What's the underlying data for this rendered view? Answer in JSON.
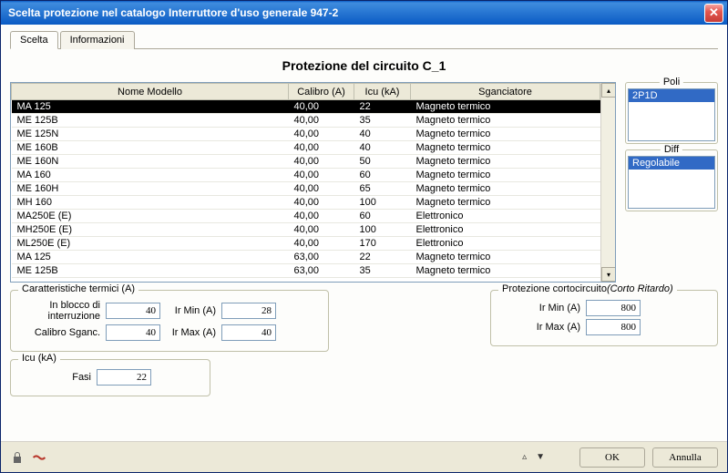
{
  "window": {
    "title": "Scelta protezione nel catalogo Interruttore d'uso generale 947-2"
  },
  "tabs": {
    "t0": "Scelta",
    "t1": "Informazioni"
  },
  "page_title": "Protezione del circuito C_1",
  "table": {
    "headers": {
      "modello": "Nome Modello",
      "calibro": "Calibro (A)",
      "icu": "Icu (kA)",
      "sganciatore": "Sganciatore"
    },
    "rows": [
      {
        "m": "MA 125",
        "c": "40,00",
        "i": "22",
        "s": "Magneto termico",
        "sel": true
      },
      {
        "m": "ME 125B",
        "c": "40,00",
        "i": "35",
        "s": "Magneto termico",
        "sel": false
      },
      {
        "m": "ME 125N",
        "c": "40,00",
        "i": "40",
        "s": "Magneto termico",
        "sel": false
      },
      {
        "m": "ME 160B",
        "c": "40,00",
        "i": "40",
        "s": "Magneto termico",
        "sel": false
      },
      {
        "m": "ME 160N",
        "c": "40,00",
        "i": "50",
        "s": "Magneto termico",
        "sel": false
      },
      {
        "m": "MA 160",
        "c": "40,00",
        "i": "60",
        "s": "Magneto termico",
        "sel": false
      },
      {
        "m": "ME 160H",
        "c": "40,00",
        "i": "65",
        "s": "Magneto termico",
        "sel": false
      },
      {
        "m": "MH 160",
        "c": "40,00",
        "i": "100",
        "s": "Magneto termico",
        "sel": false
      },
      {
        "m": "MA250E (E)",
        "c": "40,00",
        "i": "60",
        "s": "Elettronico",
        "sel": false
      },
      {
        "m": "MH250E (E)",
        "c": "40,00",
        "i": "100",
        "s": "Elettronico",
        "sel": false
      },
      {
        "m": "ML250E (E)",
        "c": "40,00",
        "i": "170",
        "s": "Elettronico",
        "sel": false
      },
      {
        "m": "MA 125",
        "c": "63,00",
        "i": "22",
        "s": "Magneto termico",
        "sel": false
      },
      {
        "m": "ME 125B",
        "c": "63,00",
        "i": "35",
        "s": "Magneto termico",
        "sel": false
      }
    ]
  },
  "side": {
    "poli": {
      "title": "Poli",
      "item": "2P1D"
    },
    "diff": {
      "title": "Diff",
      "item": "Regolabile"
    }
  },
  "groups": {
    "termici": {
      "title": "Caratteristiche termici (A)",
      "blocco_label": "In blocco di interruzione",
      "blocco_val": "40",
      "calibro_label": "Calibro Sganc.",
      "calibro_val": "40",
      "irmin_label": "Ir Min (A)",
      "irmin_val": "28",
      "irmax_label": "Ir Max (A)",
      "irmax_val": "40"
    },
    "corto": {
      "title": "Protezione cortocircuito",
      "title_italic": "(Corto Ritardo)",
      "irmin_label": "Ir Min (A)",
      "irmin_val": "800",
      "irmax_label": "Ir Max (A)",
      "irmax_val": "800"
    },
    "icu": {
      "title": "Icu (kA)",
      "fasi_label": "Fasi",
      "fasi_val": "22"
    }
  },
  "footer": {
    "ok": "OK",
    "cancel": "Annulla"
  }
}
